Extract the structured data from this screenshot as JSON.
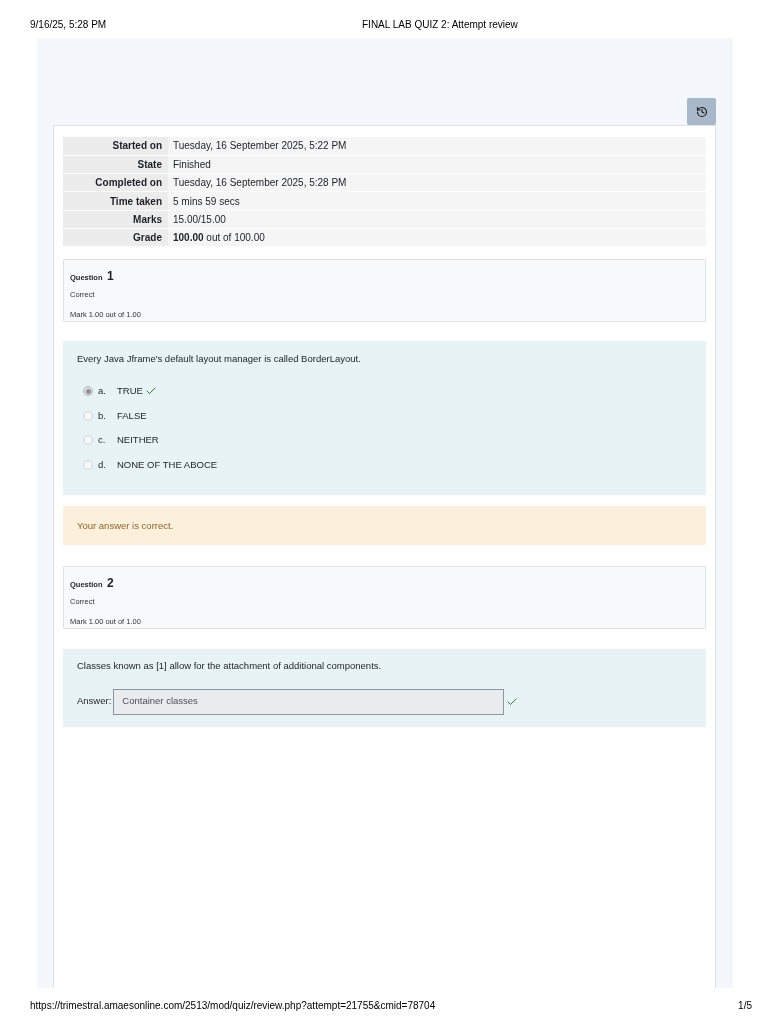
{
  "print_header": {
    "date": "9/16/25, 5:28 PM",
    "title": "FINAL LAB QUIZ 2: Attempt review"
  },
  "summary": [
    {
      "label": "Started on",
      "value": "Tuesday, 16 September 2025, 5:22 PM"
    },
    {
      "label": "State",
      "value": "Finished"
    },
    {
      "label": "Completed on",
      "value": "Tuesday, 16 September 2025, 5:28 PM"
    },
    {
      "label": "Time taken",
      "value": "5 mins 59 secs"
    },
    {
      "label": "Marks",
      "value": "15.00/15.00"
    },
    {
      "label": "Grade",
      "value": "**100.00** out of 100.00"
    }
  ],
  "questions": [
    {
      "label": "Question",
      "number": "1",
      "status": "Correct",
      "mark": "Mark 1.00 out of 1.00",
      "kind": "multichoice",
      "text": "Every Java Jframe's default layout manager is called BorderLayout.",
      "options": [
        {
          "letter": "a.",
          "text": "TRUE",
          "selected": true,
          "correct": true
        },
        {
          "letter": "b.",
          "text": "FALSE",
          "selected": false,
          "correct": false
        },
        {
          "letter": "c.",
          "text": "NEITHER",
          "selected": false,
          "correct": false
        },
        {
          "letter": "d.",
          "text": "NONE OF THE ABOCE",
          "selected": false,
          "correct": false
        }
      ],
      "feedback": "Your answer is correct."
    },
    {
      "label": "Question",
      "number": "2",
      "status": "Correct",
      "mark": "Mark 1.00 out of 1.00",
      "kind": "shortanswer",
      "text": "Classes known as [1] allow for the attachment of additional components.",
      "answer_label": "Answer:",
      "answer": "Container classes",
      "correct": true
    }
  ],
  "print_footer": {
    "url": "https://trimestral.amaesonline.com/2513/mod/quiz/review.php?attempt=21755&cmid=78704",
    "page": "1/5"
  }
}
